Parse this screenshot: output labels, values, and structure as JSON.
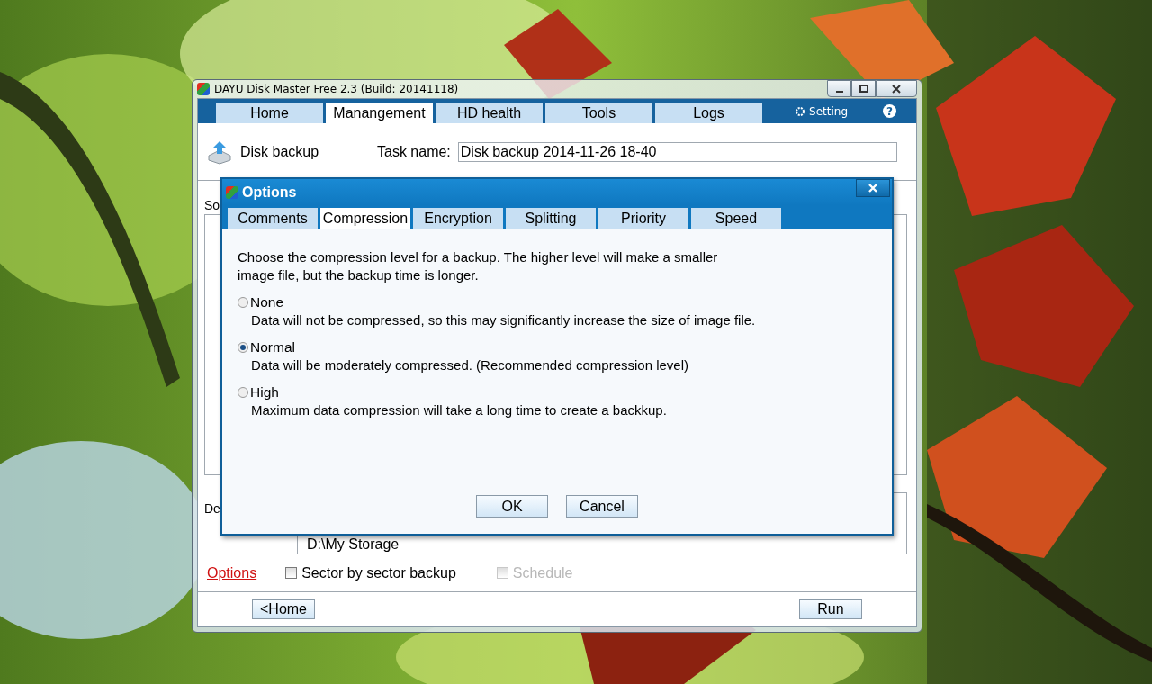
{
  "window": {
    "title": "DAYU Disk Master Free 2.3  (Build: 20141118)"
  },
  "tabs": [
    {
      "label": "Home",
      "selected": false
    },
    {
      "label": "Manangement",
      "selected": true
    },
    {
      "label": "HD health",
      "selected": false
    },
    {
      "label": "Tools",
      "selected": false
    },
    {
      "label": "Logs",
      "selected": false
    }
  ],
  "setting": {
    "label": "Setting"
  },
  "help": {
    "glyph": "?"
  },
  "header": {
    "title": "Disk backup",
    "task_label": "Task name:",
    "task_value": "Disk backup 2014-11-26 18-40"
  },
  "source": {
    "label": "So"
  },
  "destination": {
    "label": "De",
    "path": "D:\\My Storage"
  },
  "options_link": "Options",
  "checkboxes": [
    {
      "label": "Sector by sector backup",
      "checked": false,
      "disabled": false
    },
    {
      "label": "Schedule",
      "checked": false,
      "disabled": true
    }
  ],
  "buttons": {
    "back": "<Home",
    "run": "Run"
  },
  "dialog": {
    "title": "Options",
    "tabs": [
      {
        "label": "Comments",
        "selected": false
      },
      {
        "label": "Compression",
        "selected": true
      },
      {
        "label": "Encryption",
        "selected": false
      },
      {
        "label": "Splitting",
        "selected": false
      },
      {
        "label": "Priority",
        "selected": false
      },
      {
        "label": "Speed",
        "selected": false
      }
    ],
    "description_lines": [
      "Choose the compression level for a backup. The higher level will make a smaller",
      "image file, but the backup time is longer."
    ],
    "levels": [
      {
        "label": "None",
        "description": "Data will not be compressed, so this may significantly increase the size of image file.",
        "selected": false
      },
      {
        "label": "Normal",
        "description": "Data will be moderately compressed. (Recommended compression level)",
        "selected": true
      },
      {
        "label": "High",
        "description": "Maximum data compression will take a long time to create a backkup.",
        "selected": false
      }
    ],
    "buttons": [
      "OK",
      "Cancel"
    ]
  }
}
